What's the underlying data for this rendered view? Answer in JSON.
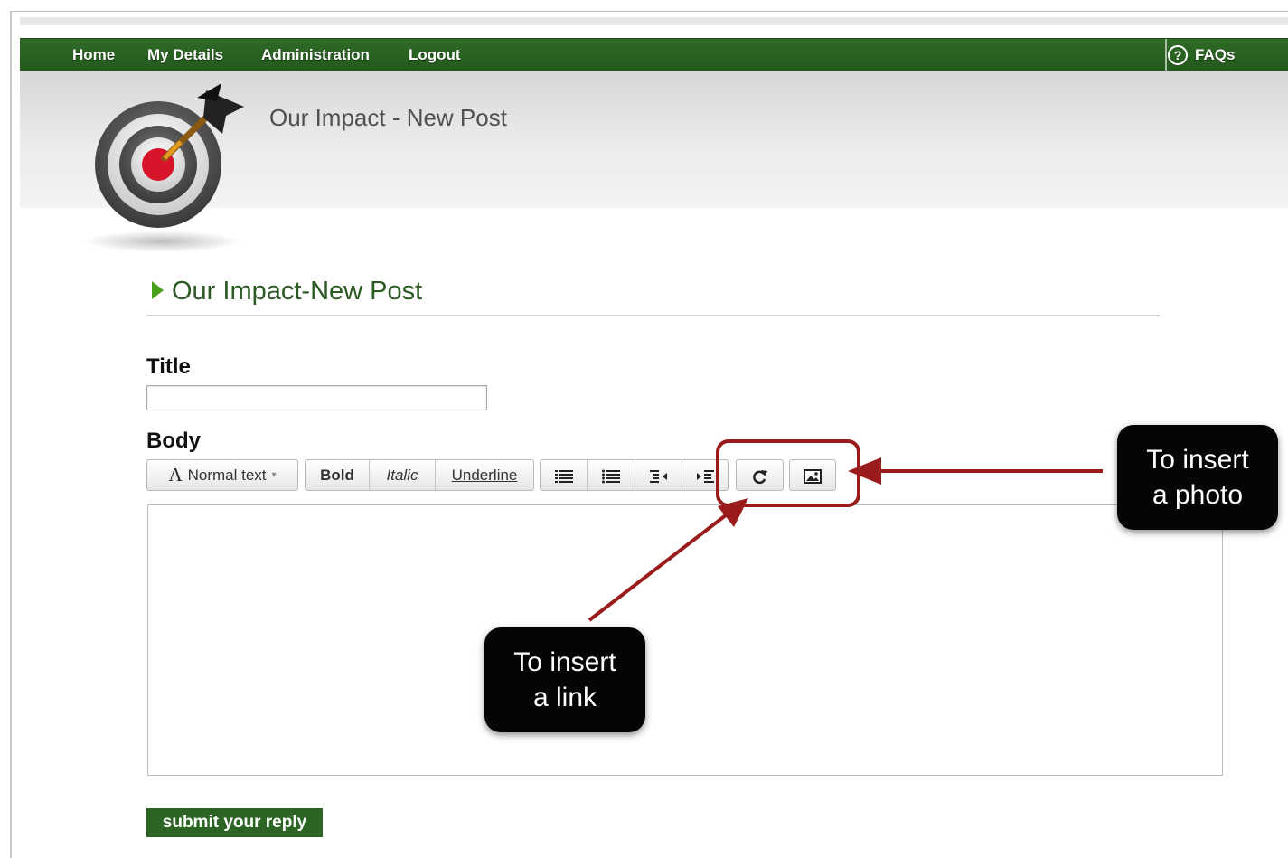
{
  "colors": {
    "nav_green": "#2f6a26",
    "heading_green": "#2b5b22",
    "arrow_green": "#48a019",
    "annotation_red": "#9a1b1b",
    "callout_black": "#050505"
  },
  "nav": {
    "items": [
      {
        "label": "Home"
      },
      {
        "label": "My Details"
      },
      {
        "label": "Administration"
      },
      {
        "label": "Logout"
      }
    ],
    "faq": {
      "icon": "help-circle-icon",
      "label": "FAQs",
      "glyph": "?"
    }
  },
  "banner": {
    "logo_icon": "dartboard-target-icon",
    "title": "Our Impact - New Post"
  },
  "section": {
    "heading": "Our Impact-New Post"
  },
  "form": {
    "title_label": "Title",
    "title_value": "",
    "body_label": "Body",
    "body_value": "",
    "submit_label": "submit your reply"
  },
  "toolbar": {
    "format_select": {
      "icon": "font-a-icon",
      "glyph": "A",
      "value": "Normal text",
      "caret": "▾"
    },
    "bold": "Bold",
    "italic": "Italic",
    "underline": "Underline",
    "list_icons": [
      {
        "icon": "numbered-list-icon"
      },
      {
        "icon": "bulleted-list-icon"
      },
      {
        "icon": "outdent-icon"
      },
      {
        "icon": "indent-icon"
      }
    ],
    "link_icon": "insert-link-icon",
    "image_icon": "insert-image-icon"
  },
  "annotations": {
    "photo_callout": "To insert\na photo",
    "link_callout": "To insert\na link"
  }
}
